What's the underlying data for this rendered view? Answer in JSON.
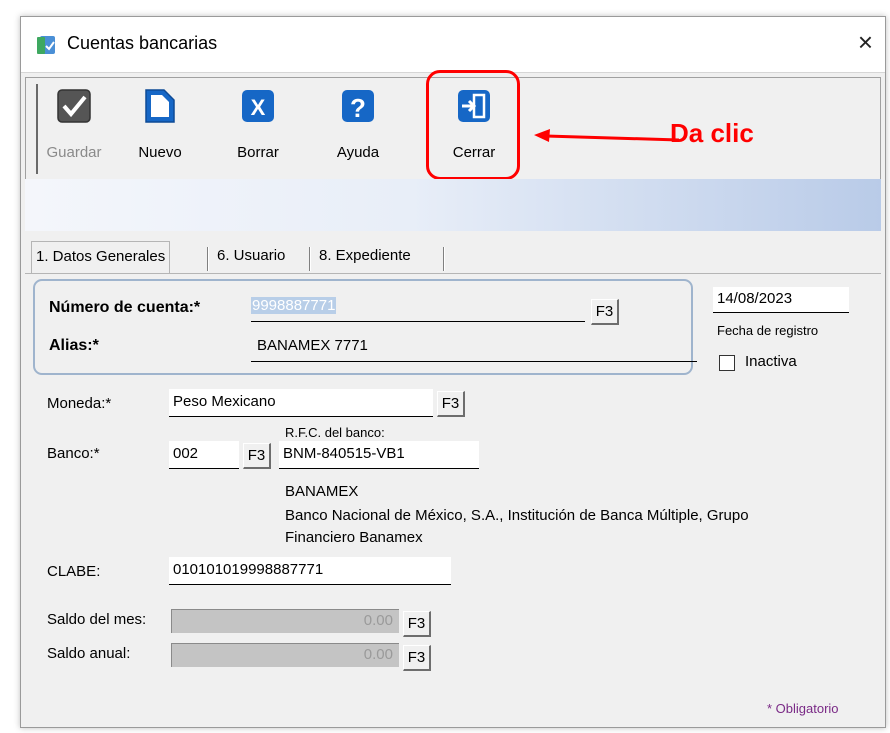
{
  "window": {
    "title": "Cuentas bancarias",
    "close": "×"
  },
  "toolbar": {
    "guardar": "Guardar",
    "nuevo": "Nuevo",
    "borrar": "Borrar",
    "ayuda": "Ayuda",
    "cerrar": "Cerrar"
  },
  "annotation": {
    "text": "Da clic",
    "color": "#ff0000"
  },
  "tabs": [
    {
      "label": "1. Datos Generales"
    },
    {
      "label": "6. Usuario"
    },
    {
      "label": "8. Expediente"
    }
  ],
  "form": {
    "numero_cuenta_label": "Número de cuenta:*",
    "numero_cuenta_value": "9998887771",
    "alias_label": "Alias:*",
    "alias_value": "BANAMEX 7771",
    "fecha_value": "14/08/2023",
    "fecha_label": "Fecha de registro",
    "inactiva_label": "Inactiva",
    "moneda_label": "Moneda:*",
    "moneda_value": "Peso Mexicano",
    "banco_label": "Banco:*",
    "banco_value": "002",
    "rfc_label": "R.F.C. del banco:",
    "rfc_value": "BNM-840515-VB1",
    "banco_nombre_corto": "BANAMEX",
    "banco_nombre_largo_1": "Banco Nacional de México, S.A., Institución de Banca Múltiple, Grupo",
    "banco_nombre_largo_2": "Financiero Banamex",
    "clabe_label": "CLABE:",
    "clabe_value": "010101019998887771",
    "saldo_mes_label": "Saldo del mes:",
    "saldo_mes_value": "0.00",
    "saldo_anual_label": "Saldo anual:",
    "saldo_anual_value": "0.00",
    "f3": "F3",
    "obligatorio": "* Obligatorio"
  }
}
